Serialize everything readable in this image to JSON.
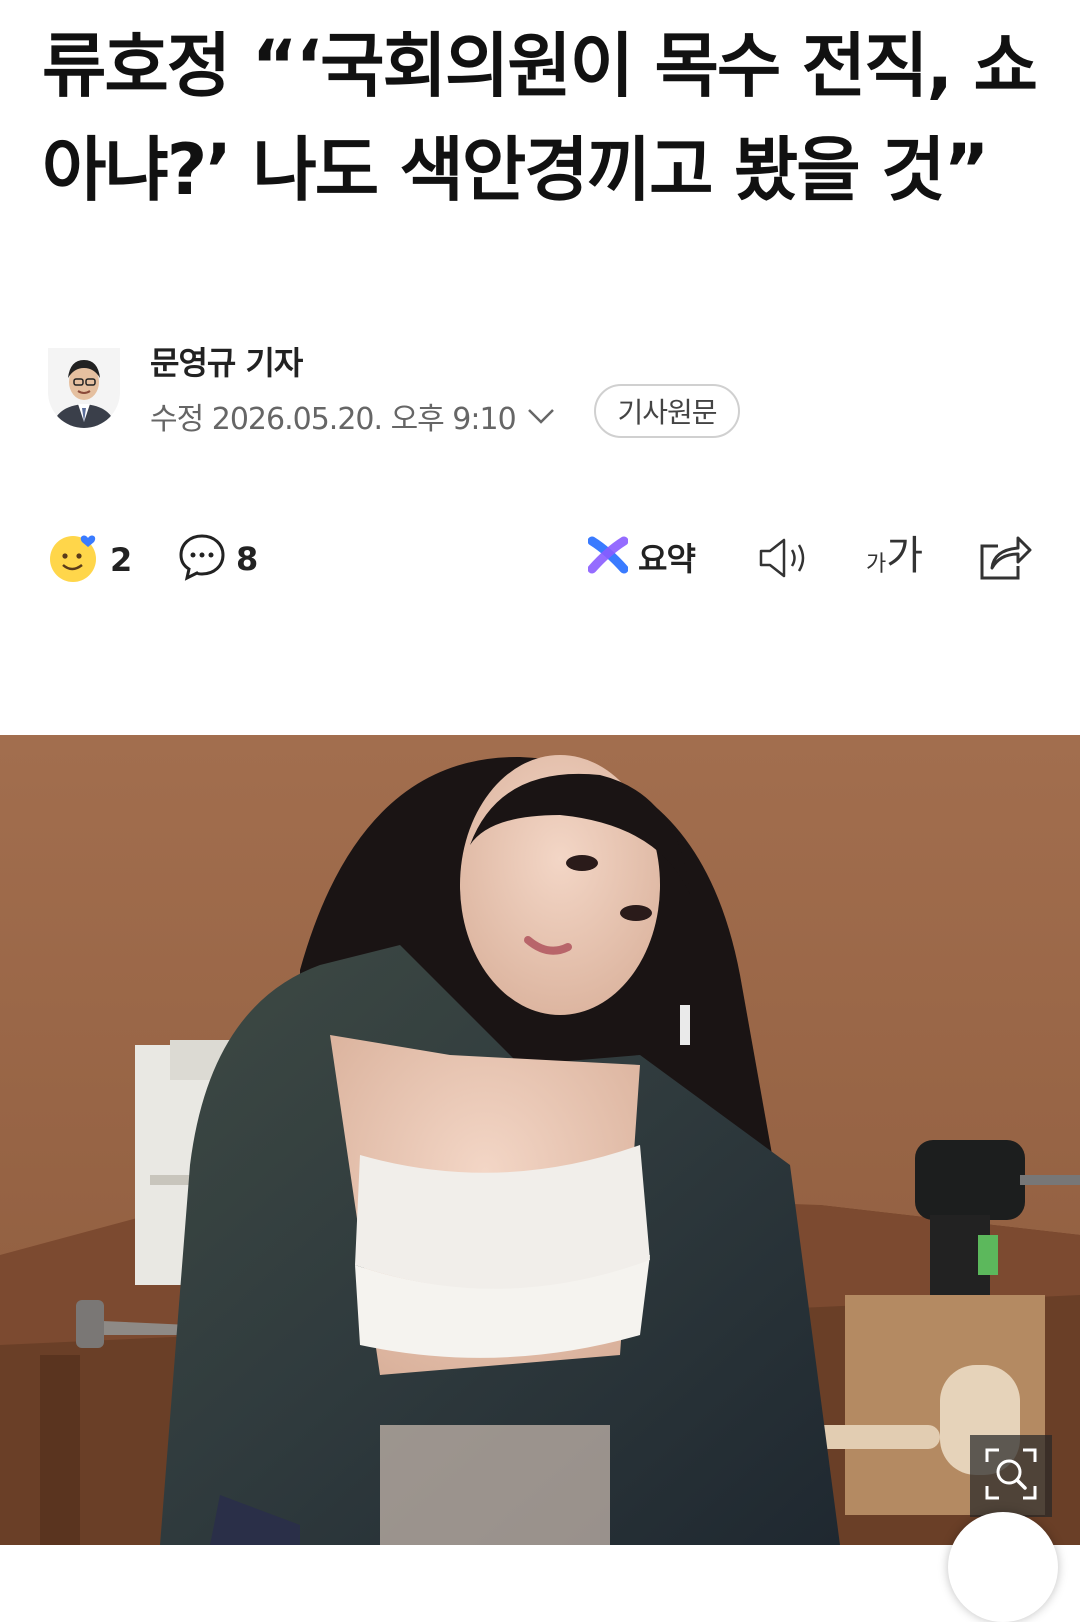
{
  "article": {
    "headline": "류호정 “‘국회의원이 목수 전직, 쇼 아냐?’ 나도 색안경끼고 봤을 것”"
  },
  "byline": {
    "reporter": "문영규 기자",
    "updated": "수정 2026.05.20. 오후 9:10",
    "original_button": "기사원문"
  },
  "actions": {
    "reactions_count": "2",
    "comments_count": "8",
    "summary_label": "요약",
    "font_small": "가",
    "font_large": "가"
  },
  "icons": [
    "smiley-icon",
    "comment-icon",
    "summary-icon",
    "speaker-icon",
    "font-size-icon",
    "share-icon",
    "zoom-icon",
    "chevron-down-icon"
  ],
  "colors": {
    "accent_blue": "#3a7bff",
    "accent_purple": "#8a5cff",
    "text_gray": "#666666"
  }
}
